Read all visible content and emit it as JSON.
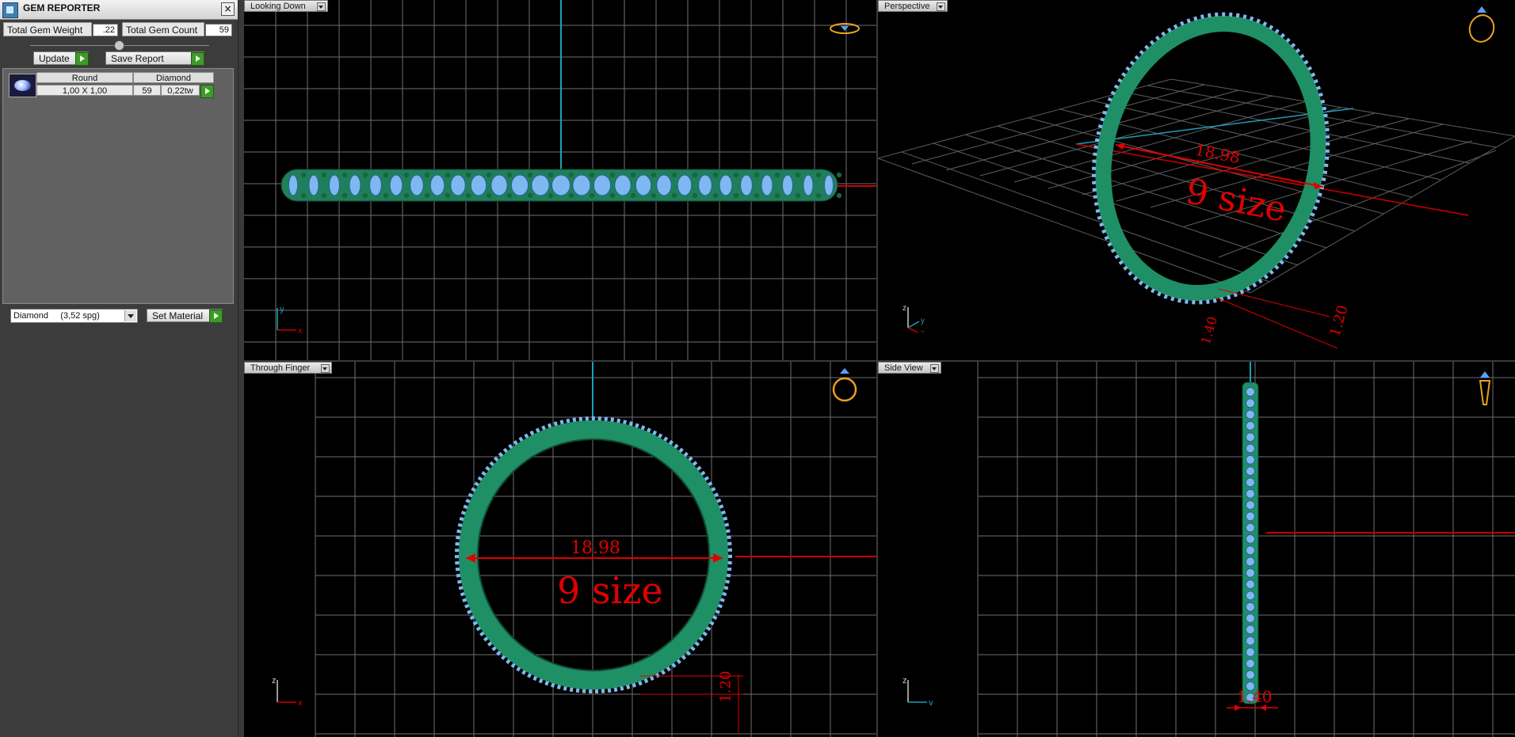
{
  "panel": {
    "title": "GEM REPORTER",
    "total_weight_label": "Total Gem Weight",
    "total_weight_value": ".22",
    "total_count_label": "Total Gem Count",
    "total_count_value": "59",
    "update_label": "Update",
    "save_report_label": "Save Report",
    "table": {
      "headers": [
        "Round",
        "Diamond"
      ],
      "row": {
        "size": "1,00 X 1,00",
        "count": "59",
        "weight": "0,22tw"
      }
    },
    "material_select": "Diamond     (3,52 spg)",
    "set_material_label": "Set Material"
  },
  "viewports": {
    "top": {
      "label": "Looking Down"
    },
    "perspective": {
      "label": "Perspective",
      "dim_diameter": "18.98",
      "size_text": "9 size",
      "dim_height": "1.20",
      "dim_width": "1.40"
    },
    "front": {
      "label": "Through Finger",
      "dim_diameter": "18.98",
      "size_text": "9 size",
      "dim_height": "1.20"
    },
    "side": {
      "label": "Side View",
      "dim_width": "1.40"
    }
  },
  "axes": {
    "x": "x",
    "y": "y",
    "z": "z"
  },
  "colors": {
    "metal": "#1f8f66",
    "gem": "#7fb8f0",
    "dimension": "#e10000",
    "grid": "#6f6f6f",
    "axis_cyan": "#1c9fb8",
    "icon_gold": "#e8a21c"
  }
}
